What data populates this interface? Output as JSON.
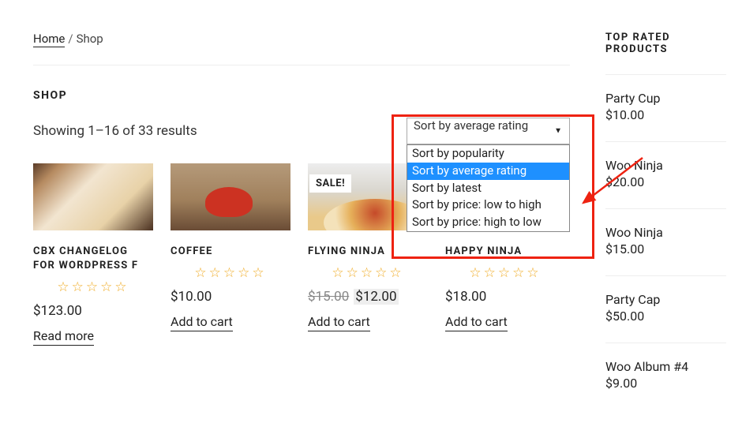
{
  "breadcrumb": {
    "home": "Home",
    "current": "Shop"
  },
  "page_title": "SHOP",
  "results_text": "Showing 1–16 of 33 results",
  "sort": {
    "selected": "Sort by average rating",
    "options": [
      "Sort by popularity",
      "Sort by average rating",
      "Sort by latest",
      "Sort by price: low to high",
      "Sort by price: high to low"
    ],
    "selected_index": 1
  },
  "sale_label": "SALE!",
  "products": [
    {
      "title": "CBX CHANGELOG FOR WORDPRESS F",
      "price": "$123.00",
      "cta": "Read more",
      "stars": "☆☆☆☆☆"
    },
    {
      "title": "COFFEE",
      "price": "$10.00",
      "cta": "Add to cart",
      "stars": "☆☆☆☆☆"
    },
    {
      "title": "FLYING NINJA",
      "old_price": "$15.00",
      "price": "$12.00",
      "cta": "Add to cart",
      "stars": "☆☆☆☆☆",
      "on_sale": true
    },
    {
      "title": "HAPPY NINJA",
      "price": "$18.00",
      "cta": "Add to cart",
      "stars": "☆☆☆☆☆"
    }
  ],
  "sidebar": {
    "title": "TOP RATED PRODUCTS",
    "items": [
      {
        "name": "Party Cup",
        "price": "$10.00"
      },
      {
        "name": "Woo Ninja",
        "price": "$20.00"
      },
      {
        "name": "Woo Ninja",
        "price": "$15.00"
      },
      {
        "name": "Party Cap",
        "price": "$50.00"
      },
      {
        "name": "Woo Album #4",
        "price": "$9.00"
      }
    ]
  }
}
